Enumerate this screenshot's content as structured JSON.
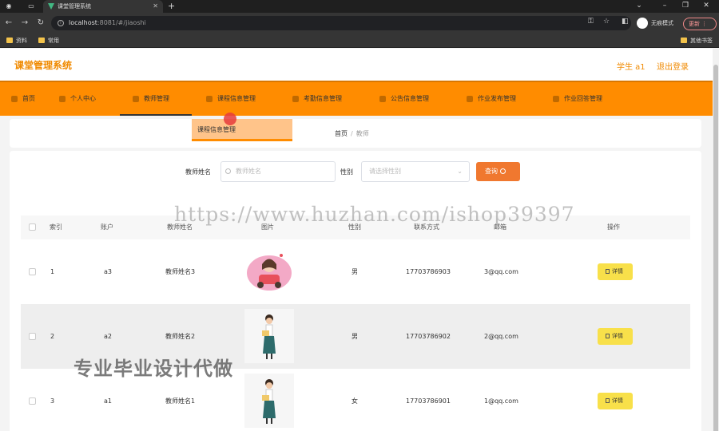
{
  "browser": {
    "tab_title": "课堂管理系统",
    "url_host": "localhost",
    "url_path": ":8081/#/jiaoshi",
    "incognito_label": "无痕模式",
    "update_label": "更新",
    "bookmarks": [
      "资料",
      "常用"
    ],
    "other_bookmarks": "其他书签"
  },
  "header": {
    "title": "课堂管理系统",
    "user": "学生 a1",
    "logout": "退出登录"
  },
  "menu": {
    "items": [
      {
        "label": "首页"
      },
      {
        "label": "个人中心"
      },
      {
        "label": "教师管理"
      },
      {
        "label": "课程信息管理"
      },
      {
        "label": "考勤信息管理"
      },
      {
        "label": "公告信息管理"
      },
      {
        "label": "作业发布管理"
      },
      {
        "label": "作业回答管理"
      }
    ],
    "dropdown_item": "课程信息管理"
  },
  "breadcrumb": {
    "home": "首页",
    "sep": "/",
    "current": "教师"
  },
  "search": {
    "name_label": "教师姓名",
    "name_placeholder": "教师姓名",
    "gender_label": "性别",
    "gender_placeholder": "请选择性别",
    "query_label": "查询"
  },
  "table": {
    "headers": {
      "index": "索引",
      "account": "账户",
      "name": "教师姓名",
      "picture": "图片",
      "gender": "性别",
      "phone": "联系方式",
      "email": "邮箱",
      "action": "操作"
    },
    "rows": [
      {
        "index": "1",
        "account": "a3",
        "name": "教师姓名3",
        "gender": "男",
        "phone": "17703786903",
        "email": "3@qq.com",
        "action": "详情"
      },
      {
        "index": "2",
        "account": "a2",
        "name": "教师姓名2",
        "gender": "男",
        "phone": "17703786902",
        "email": "2@qq.com",
        "action": "详情"
      },
      {
        "index": "3",
        "account": "a1",
        "name": "教师姓名1",
        "gender": "女",
        "phone": "17703786901",
        "email": "1@qq.com",
        "action": "详情"
      }
    ]
  },
  "watermarks": {
    "url": "https://www.huzhan.com/ishop39397",
    "promo": "专业毕业设计代做"
  },
  "colors": {
    "accent": "#ff8c00",
    "title": "#f08a00",
    "query_button": "#f0782f",
    "detail_button": "#f8e04a"
  }
}
